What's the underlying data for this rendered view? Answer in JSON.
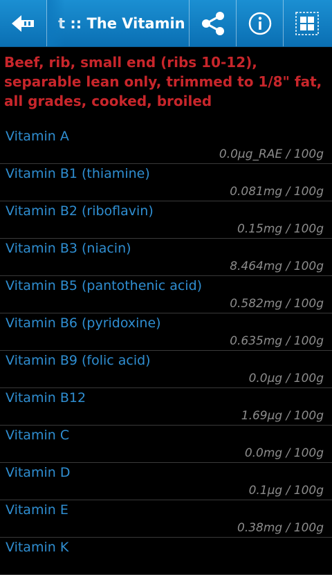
{
  "header": {
    "title": "t :: The Vitamin",
    "back_icon": "back-arrow-icon",
    "share_icon": "share-icon",
    "info_icon": "info-icon",
    "grid_icon": "grid-icon"
  },
  "food_title": "Beef, rib, small end (ribs 10-12), separable lean only, trimmed to 1/8\" fat, all grades, cooked, broiled",
  "vitamins": [
    {
      "name": "Vitamin A",
      "amount": "0.0µg_RAE / 100g"
    },
    {
      "name": "Vitamin B1 (thiamine)",
      "amount": "0.081mg / 100g"
    },
    {
      "name": "Vitamin B2 (riboflavin)",
      "amount": "0.15mg / 100g"
    },
    {
      "name": "Vitamin B3 (niacin)",
      "amount": "8.464mg / 100g"
    },
    {
      "name": "Vitamin B5 (pantothenic acid)",
      "amount": "0.582mg / 100g"
    },
    {
      "name": "Vitamin B6 (pyridoxine)",
      "amount": "0.635mg / 100g"
    },
    {
      "name": "Vitamin B9 (folic acid)",
      "amount": "0.0µg / 100g"
    },
    {
      "name": "Vitamin B12",
      "amount": "1.69µg / 100g"
    },
    {
      "name": "Vitamin C",
      "amount": "0.0mg / 100g"
    },
    {
      "name": "Vitamin D",
      "amount": "0.1µg / 100g"
    },
    {
      "name": "Vitamin E",
      "amount": "0.38mg / 100g"
    },
    {
      "name": "Vitamin K",
      "amount": ""
    }
  ],
  "colors": {
    "appbar": "#1582c6",
    "food_title": "#c8262b",
    "vitamin_name": "#2f8ed1",
    "amount": "#8c8c8c"
  }
}
